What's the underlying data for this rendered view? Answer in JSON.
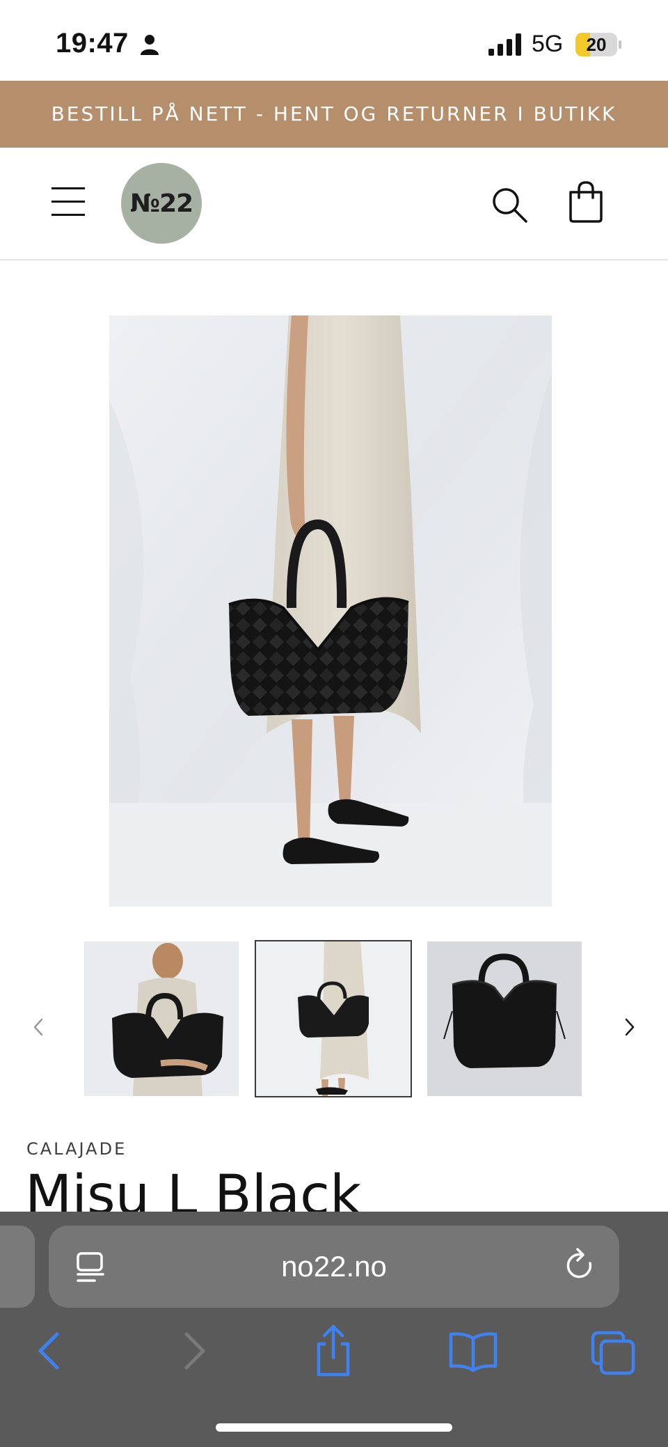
{
  "status_bar": {
    "time": "19:47",
    "network": "5G",
    "battery": "20",
    "icons": [
      "person-icon",
      "signal-icon",
      "battery-icon"
    ]
  },
  "announcement": {
    "text": "BESTILL PÅ NETT - HENT OG RETURNER I BUTIKK"
  },
  "header": {
    "logo_text": "№22",
    "icons": [
      "menu-icon",
      "search-icon",
      "cart-icon"
    ]
  },
  "product": {
    "vendor": "CALAJADE",
    "title": "Misu L Black",
    "thumbnails": [
      "thumbnail-model-holding-bag",
      "thumbnail-full-look",
      "thumbnail-bag-only"
    ],
    "selected_thumbnail": 2
  },
  "browser": {
    "url": "no22.no",
    "icons": [
      "page-settings-icon",
      "reload-icon",
      "back-icon",
      "forward-icon",
      "share-icon",
      "bookmarks-icon",
      "tabs-icon"
    ]
  },
  "colors": {
    "announcement_bg": "#b58f6b",
    "logo_bg": "#a6b0a3",
    "browser_bg": "#5a5a5a",
    "ios_blue": "#3d82f0"
  }
}
